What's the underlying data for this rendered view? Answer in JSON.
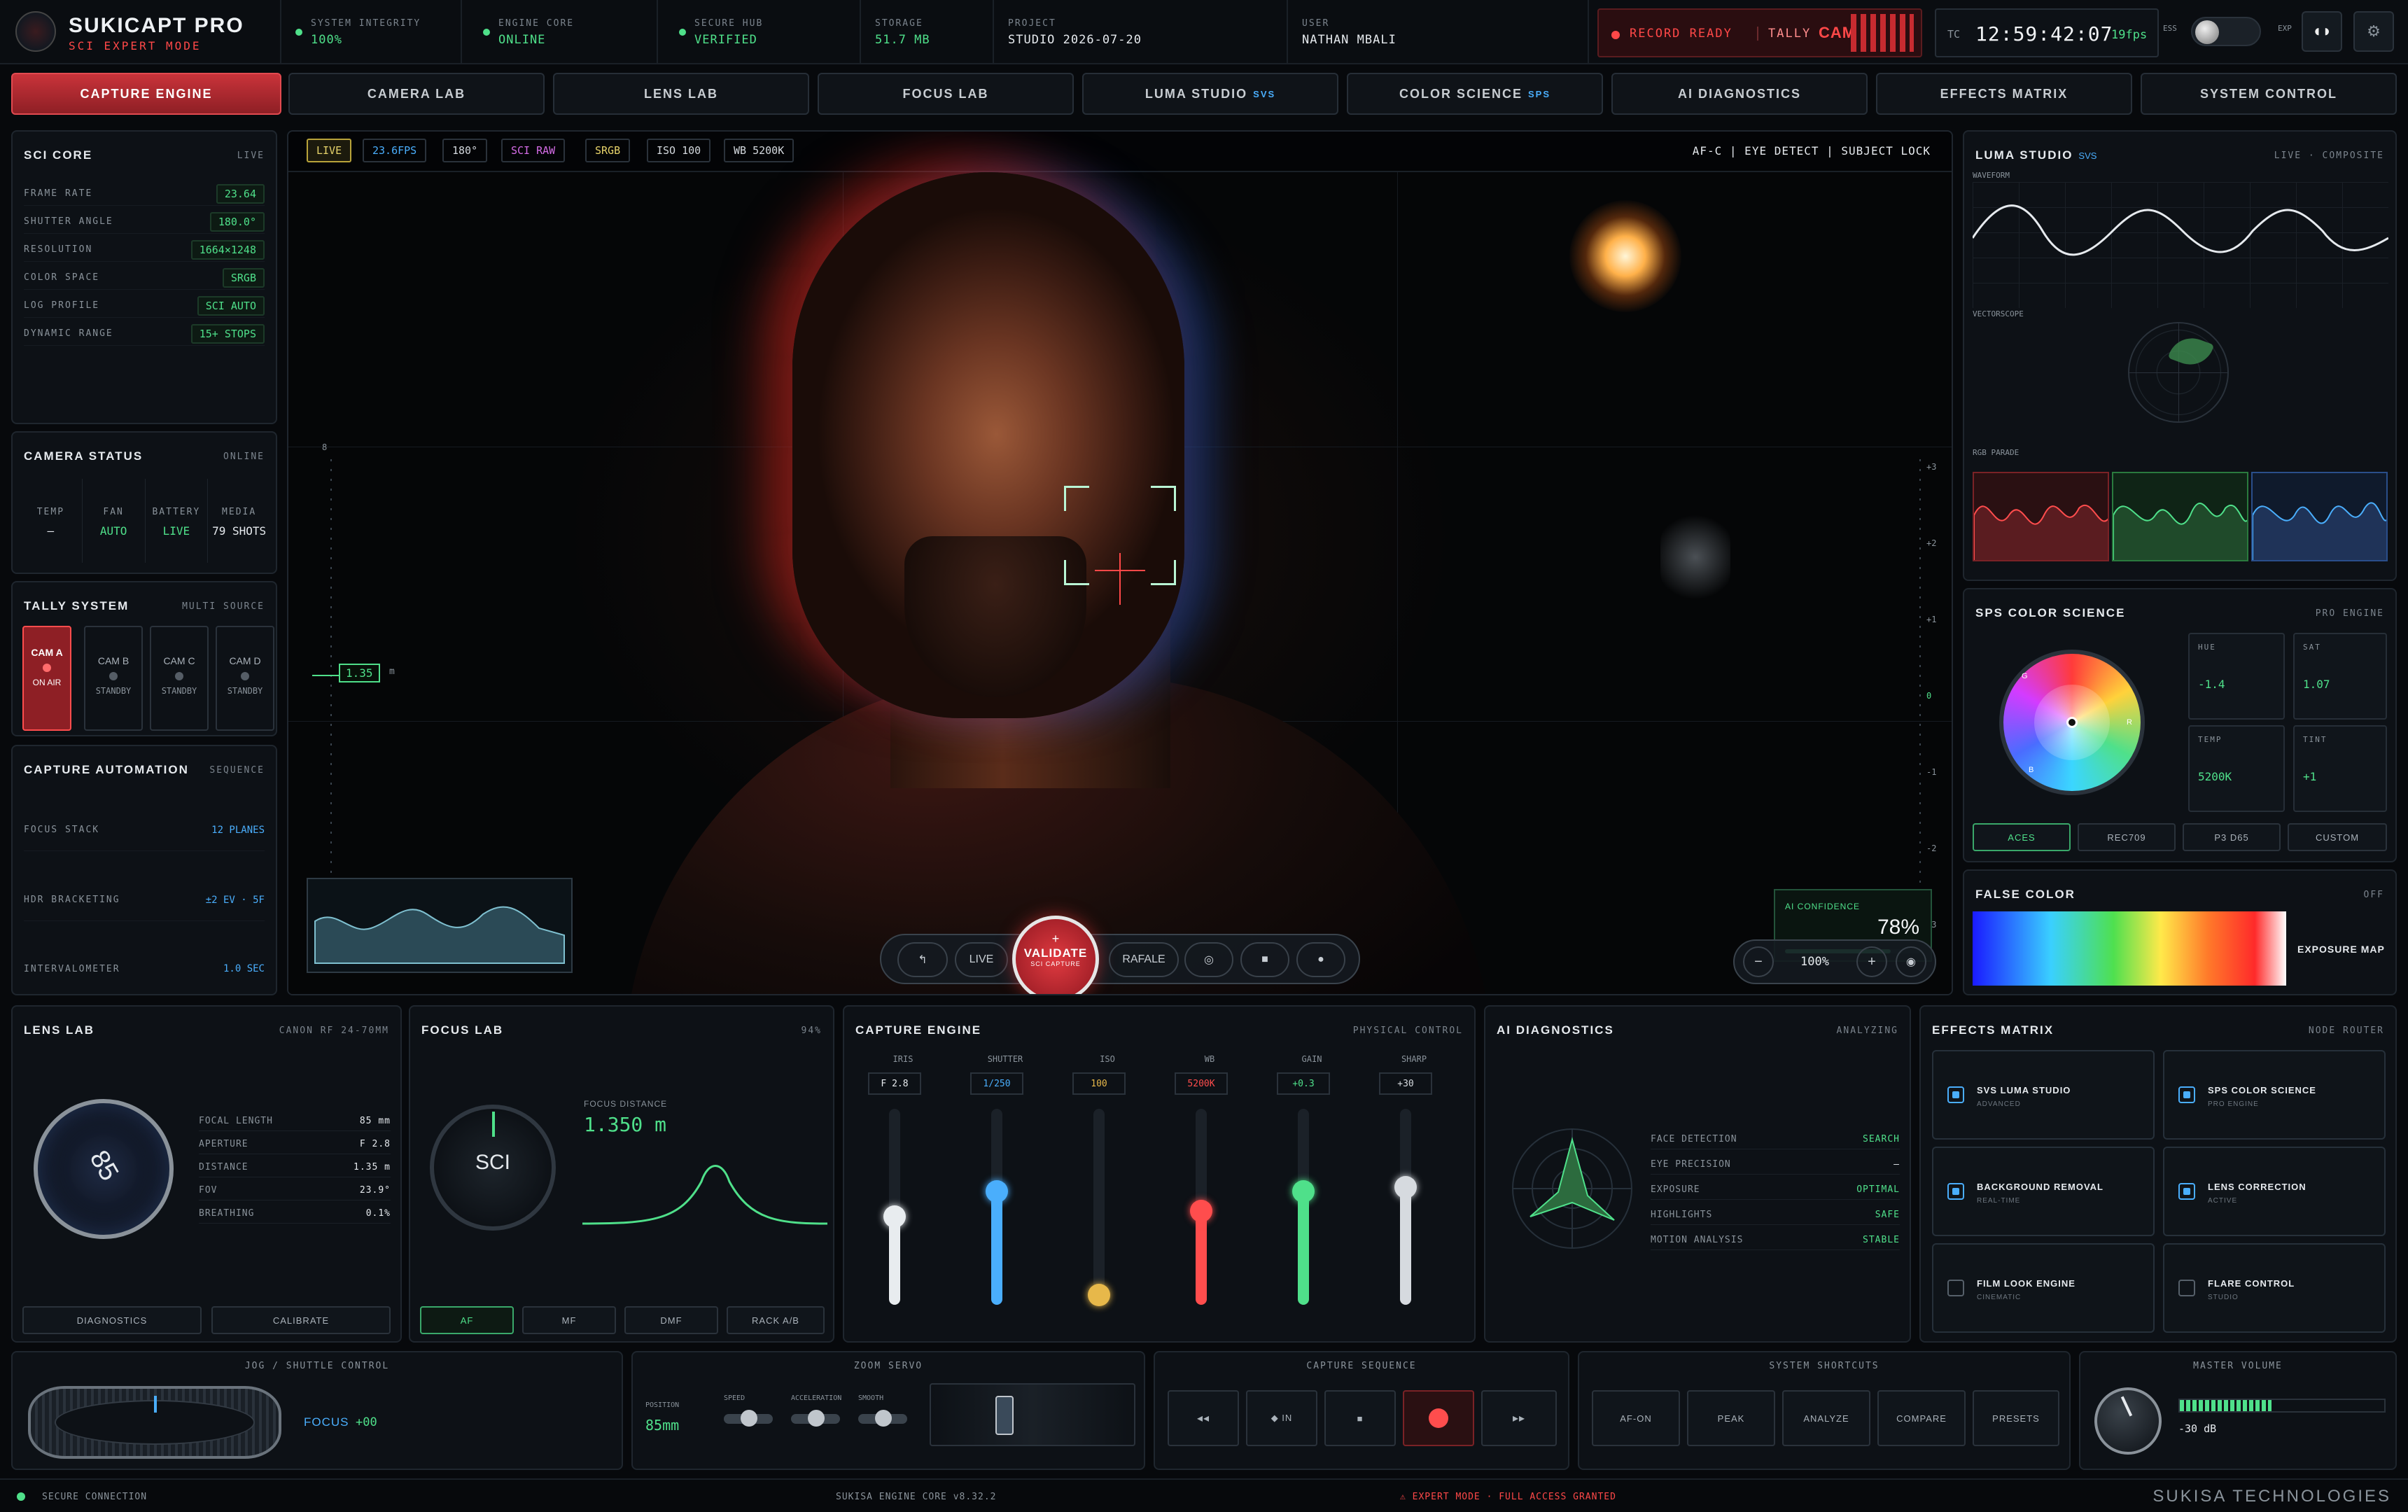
{
  "header": {
    "app_name": "SUKICAPT PRO",
    "app_mode": "SCI EXPERT MODE",
    "stats": [
      {
        "label": "SYSTEM INTEGRITY",
        "value": "100%"
      },
      {
        "label": "ENGINE CORE",
        "value": "ONLINE"
      },
      {
        "label": "SECURE HUB",
        "value": "VERIFIED"
      },
      {
        "label": "STORAGE",
        "value": "51.7 MB"
      },
      {
        "label": "PROJECT",
        "value": "STUDIO 2026-07-20"
      },
      {
        "label": "USER",
        "value": "NATHAN MBALI"
      }
    ],
    "record_status": "RECORD READY",
    "tally_label": "TALLY",
    "tally_cam": "CAM A",
    "tc_label": "TC",
    "timecode": "12:59:42:07",
    "fps": "19fps",
    "ess_label": "ESS",
    "exp_label": "EXP"
  },
  "tabs": [
    "CAPTURE ENGINE",
    "CAMERA LAB",
    "LENS LAB",
    "FOCUS LAB",
    "LUMA STUDIO",
    "COLOR SCIENCE",
    "AI DIAGNOSTICS",
    "EFFECTS MATRIX",
    "SYSTEM CONTROL"
  ],
  "tab_badges": {
    "luma": "SVS",
    "color": "SPS"
  },
  "sci_core": {
    "title": "SCI CORE",
    "meta": "LIVE",
    "rows": [
      {
        "label": "FRAME RATE",
        "value": "23.64"
      },
      {
        "label": "SHUTTER ANGLE",
        "value": "180.0°"
      },
      {
        "label": "RESOLUTION",
        "value": "1664×1248"
      },
      {
        "label": "COLOR SPACE",
        "value": "SRGB"
      },
      {
        "label": "LOG PROFILE",
        "value": "SCI AUTO"
      },
      {
        "label": "DYNAMIC RANGE",
        "value": "15+ STOPS"
      }
    ]
  },
  "camera_status": {
    "title": "CAMERA STATUS",
    "meta": "ONLINE",
    "items": [
      {
        "label": "TEMP",
        "value": "—"
      },
      {
        "label": "FAN",
        "value": "AUTO"
      },
      {
        "label": "BATTERY",
        "value": "LIVE"
      },
      {
        "label": "MEDIA",
        "value": "79 SHOTS"
      }
    ]
  },
  "tally_system": {
    "title": "TALLY SYSTEM",
    "meta": "MULTI SOURCE",
    "cams": [
      {
        "name": "CAM A",
        "state": "ON AIR"
      },
      {
        "name": "CAM B",
        "state": "STANDBY"
      },
      {
        "name": "CAM C",
        "state": "STANDBY"
      },
      {
        "name": "CAM D",
        "state": "STANDBY"
      }
    ]
  },
  "capture_automation": {
    "title": "CAPTURE AUTOMATION",
    "meta": "SEQUENCE",
    "rows": [
      {
        "label": "FOCUS STACK",
        "value": "12 PLANES"
      },
      {
        "label": "HDR BRACKETING",
        "value": "±2 EV · 5F"
      },
      {
        "label": "INTERVALOMETER",
        "value": "1.0 SEC"
      }
    ]
  },
  "viewer": {
    "chips": [
      "LIVE",
      "23.6FPS",
      "180°",
      "SCI RAW",
      "SRGB",
      "ISO 100",
      "WB 5200K"
    ],
    "af_status": "AF-C | EYE DETECT | SUBJECT LOCK",
    "scale_top": "8",
    "focus_distance_tag": "1.35",
    "focus_unit": "m",
    "ev_scale": [
      "+3",
      "+2",
      "+1",
      "0",
      "-1",
      "-2",
      "-3"
    ],
    "ai_confidence_label": "AI CONFIDENCE",
    "ai_confidence_value": "78%",
    "ai_confidence": 0.78,
    "control_live": "LIVE",
    "control_rafale": "RAFALE",
    "validate_label": "VALIDATE",
    "validate_sub": "SCI CAPTURE",
    "zoom_minus": "−",
    "zoom_value": "100%",
    "zoom_plus": "+"
  },
  "luma_studio": {
    "title": "LUMA STUDIO",
    "badge": "SVS",
    "meta": "LIVE · COMPOSITE",
    "waveform_label": "WAVEFORM",
    "vectorscope_label": "VECTORSCOPE",
    "parade_label": "RGB PARADE"
  },
  "color_science": {
    "title": "SPS COLOR SCIENCE",
    "meta": "PRO ENGINE",
    "wheel_labels": [
      "G",
      "R",
      "B"
    ],
    "params": [
      {
        "label": "HUE",
        "value": "-1.4"
      },
      {
        "label": "SAT",
        "value": "1.07"
      },
      {
        "label": "TEMP",
        "value": "5200K"
      },
      {
        "label": "TINT",
        "value": "+1"
      }
    ],
    "modes": [
      "ACES",
      "REC709",
      "P3 D65",
      "CUSTOM"
    ]
  },
  "false_color": {
    "title": "FALSE COLOR",
    "meta": "OFF",
    "label": "EXPOSURE MAP"
  },
  "lens_lab": {
    "title": "LENS LAB",
    "meta": "CANON RF 24-70MM",
    "dial_value": "85",
    "specs": [
      {
        "label": "FOCAL LENGTH",
        "value": "85 mm"
      },
      {
        "label": "APERTURE",
        "value": "F 2.8"
      },
      {
        "label": "DISTANCE",
        "value": "1.35 m"
      },
      {
        "label": "FOV",
        "value": "23.9°"
      },
      {
        "label": "BREATHING",
        "value": "0.1%"
      }
    ],
    "buttons": [
      "DIAGNOSTICS",
      "CALIBRATE"
    ]
  },
  "focus_lab": {
    "title": "FOCUS LAB",
    "meta": "94%",
    "dial_label": "SCI",
    "distance_label": "FOCUS DISTANCE",
    "distance_value": "1.350 m",
    "modes": [
      "AF",
      "MF",
      "DMF",
      "RACK A/B"
    ]
  },
  "capture_engine_panel": {
    "title": "CAPTURE ENGINE",
    "meta": "PHYSICAL CONTROL",
    "sliders": [
      {
        "label": "IRIS",
        "value": "F 2.8",
        "level": 0.45,
        "color": "#e8ecef"
      },
      {
        "label": "SHUTTER",
        "value": "1/250",
        "level": 0.58,
        "color": "#4aaefc"
      },
      {
        "label": "ISO",
        "value": "100",
        "level": 0.05,
        "color": "#e7b84a"
      },
      {
        "label": "WB",
        "value": "5200K",
        "level": 0.48,
        "color": "#ff4d4d"
      },
      {
        "label": "GAIN",
        "value": "+0.3",
        "level": 0.58,
        "color": "#4fe08a"
      },
      {
        "label": "SHARP",
        "value": "+30",
        "level": 0.6,
        "color": "#d6dadf"
      }
    ]
  },
  "ai_diagnostics": {
    "title": "AI DIAGNOSTICS",
    "meta": "ANALYZING",
    "rows": [
      {
        "label": "FACE DETECTION",
        "value": "SEARCH"
      },
      {
        "label": "EYE PRECISION",
        "value": "—"
      },
      {
        "label": "EXPOSURE",
        "value": "OPTIMAL"
      },
      {
        "label": "HIGHLIGHTS",
        "value": "SAFE"
      },
      {
        "label": "MOTION ANALYSIS",
        "value": "STABLE"
      }
    ]
  },
  "effects_matrix": {
    "title": "EFFECTS MATRIX",
    "meta": "NODE ROUTER",
    "nodes": [
      {
        "name": "SVS LUMA STUDIO",
        "sub": "ADVANCED"
      },
      {
        "name": "SPS COLOR SCIENCE",
        "sub": "PRO ENGINE"
      },
      {
        "name": "BACKGROUND REMOVAL",
        "sub": "REAL-TIME"
      },
      {
        "name": "LENS CORRECTION",
        "sub": "ACTIVE"
      },
      {
        "name": "FILM LOOK ENGINE",
        "sub": "CINEMATIC"
      },
      {
        "name": "FLARE CONTROL",
        "sub": "STUDIO"
      }
    ]
  },
  "jog": {
    "title": "JOG / SHUTTLE CONTROL",
    "mode": "FOCUS",
    "value": "+00"
  },
  "zoom_servo": {
    "title": "ZOOM SERVO",
    "position_label": "POSITION",
    "position_value": "85mm",
    "knobs": [
      "SPEED",
      "ACCELERATION",
      "SMOOTH"
    ]
  },
  "capture_sequence": {
    "title": "CAPTURE SEQUENCE",
    "buttons": [
      "◂◂",
      "◆ IN",
      "■",
      "",
      "▸▸"
    ]
  },
  "shortcuts": {
    "title": "SYSTEM SHORTCUTS",
    "buttons": [
      "AF-ON",
      "PEAK",
      "ANALYZE",
      "COMPARE",
      "PRESETS"
    ]
  },
  "master_volume": {
    "title": "MASTER VOLUME",
    "value": "-30 dB",
    "level": 0.45
  },
  "footer": {
    "connection": "SECURE CONNECTION",
    "version": "SUKISA ENGINE CORE v8.32.2",
    "mode": "⚠ EXPERT MODE · FULL ACCESS GRANTED",
    "brand": "SUKISA TECHNOLOGIES"
  },
  "colors": {
    "accent_red": "#ff4848",
    "accent_green": "#4fe08a",
    "accent_blue": "#4aaefc",
    "background": "#07090c"
  }
}
